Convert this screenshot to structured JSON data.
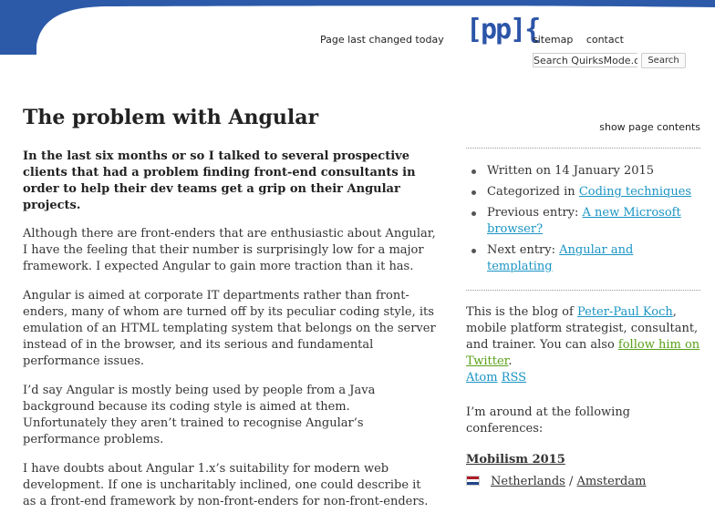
{
  "header": {
    "last_changed": "Page last changed today",
    "logo_text": "[pp]{",
    "sitemap": "sitemap",
    "contact": "contact",
    "search_value": "Search QuirksMode.org",
    "search_button": "Search",
    "brand_color": "#2c5aa8"
  },
  "article": {
    "title": "The problem with Angular",
    "show_contents": "show page contents",
    "paragraphs": [
      "In the last six months or so I talked to several prospective clients that had a problem finding front-end consultants in order to help their dev teams get a grip on their Angular projects.",
      "Although there are front-enders that are enthusiastic about Angular, I have the feeling that their number is surprisingly low for a major framework. I expected Angular to gain more traction than it has.",
      "Angular is aimed at corporate IT departments rather than front-enders, many of whom are turned off by its peculiar coding style, its emulation of an HTML templating system that belongs on the server instead of in the browser, and its serious and fundamental performance issues.",
      "I’d say Angular is mostly being used by people from a Java background because its coding style is aimed at them. Unfortunately they aren’t trained to recognise Angular’s performance problems.",
      "I have doubts about Angular 1.x’s suitability for modern web development. If one is uncharitably inclined, one could describe it as a front-end framework by non-front-enders for non-front-enders."
    ]
  },
  "sidebar": {
    "written_prefix": "Written on 14 January 2015",
    "categorized_prefix": "Categorized in",
    "categorized_link": "Coding techniques",
    "previous_prefix": "Previous entry:",
    "previous_link": "A new Microsoft browser?",
    "next_prefix": "Next entry:",
    "next_link": "Angular and templating",
    "bio_prefix": "This is the blog of",
    "bio_name": "Peter-Paul Koch",
    "bio_mid": ", mobile platform strategist, consultant, and trainer. You can also",
    "bio_follow": "follow him on Twitter",
    "bio_end": ".",
    "atom": "Atom",
    "rss": "RSS",
    "conferences_intro": "I’m around at the following conferences:",
    "conference_title": "Mobilism 2015",
    "country": "Netherlands",
    "separator": "/",
    "city": "Amsterdam"
  }
}
